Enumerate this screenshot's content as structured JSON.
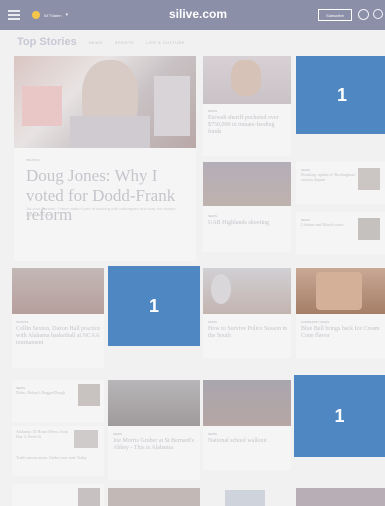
{
  "header": {
    "weather_label": "54°Staten",
    "brand": "silive.com",
    "subscribe_label": "Subscribe"
  },
  "section": {
    "title": "Top Stories",
    "links": [
      "NEWS",
      "SPORTS",
      "LIFE & CULTURE"
    ]
  },
  "stories": {
    "main_tag": "POLITICS",
    "main_headline": "Doug Jones: Why I voted for Dodd-Frank reform",
    "main_body": "'As your Senator, I have made it part of working with colleagues who may not always agree with me.'",
    "col2_tag1": "NEWS",
    "col2_headline1": "Etowah sheriff pocketed over $750,000 in inmate-feeding funds",
    "col2_tag2": "NEWS",
    "col2_headline2": "UAB Highlands shooting",
    "col3_tag1": "NEWS",
    "col3_headline1": "Breaking: update of 'Rockingham' auction dispute",
    "col3_tag2": "NEWS",
    "col3_headline2": "Lifetime and Marsh voters",
    "row2_tag1": "SPORTS",
    "row2_headline1": "Collin Sexton, Dazon Hall practice with Alabama basketball at NCAA tournament",
    "row2_tag2": "NEWS",
    "row2_headline2": "How to Survive Police Season in the South",
    "row2_tag3": "COMMUNITY NEWS",
    "row2_headline3": "Blue Bell brings back Ice Cream Cone flavor",
    "row3_tag1": "NEWS",
    "row3_headline1": "Daleo, Robyn's Nugget/Dough",
    "row3_tag2": "NEWS",
    "row3_headline2": "Joe Morris Gruber at St Bernard's Abbey - This is Alabama",
    "row3_tag3": "NEWS",
    "row3_headline3": "National school walkout",
    "row3_list1": "Alabama: 35 Hours Metro, from Day 4: Fresh St",
    "row3_list2": "Trade season meets: Under your state Today"
  },
  "ads": [
    "1",
    "1",
    "1"
  ]
}
